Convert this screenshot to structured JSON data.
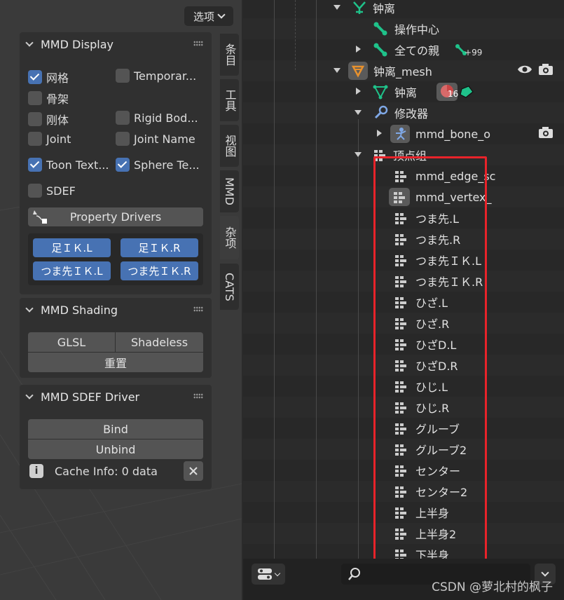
{
  "viewport": {
    "options_label": "选项",
    "tabs": [
      "条目",
      "工具",
      "视图",
      "MMD",
      "杂项",
      "CATS"
    ],
    "active_tab": "杂项"
  },
  "mmd_display": {
    "title": "MMD Display",
    "checks": [
      {
        "label": "网格",
        "checked": true
      },
      {
        "label": "Temporar...",
        "checked": false
      },
      {
        "label": "骨架",
        "checked": false
      },
      {
        "label": "刚体",
        "checked": false
      },
      {
        "label": "Rigid Bod...",
        "checked": false
      },
      {
        "label": "Joint",
        "checked": false
      },
      {
        "label": "Joint Name",
        "checked": false
      },
      {
        "label": "Toon Text...",
        "checked": true
      },
      {
        "label": "Sphere Te...",
        "checked": true
      },
      {
        "label": "SDEF",
        "checked": false
      }
    ],
    "property_drivers": "Property Drivers",
    "ik_buttons": [
      "足ＩＫ.L",
      "足ＩＫ.R",
      "つま先ＩＫ.L",
      "つま先ＩＫ.R"
    ]
  },
  "mmd_shading": {
    "title": "MMD Shading",
    "glsl": "GLSL",
    "shadeless": "Shadeless",
    "reset": "重置"
  },
  "mmd_sdef": {
    "title": "MMD SDEF Driver",
    "bind": "Bind",
    "unbind": "Unbind",
    "cache_info": "Cache Info: 0 data"
  },
  "outliner": {
    "armature": "钟离",
    "op_center": "操作中心",
    "all_parent": "全ての親",
    "all_parent_badge": "99",
    "mesh": "钟离_mesh",
    "mesh_data": "钟离",
    "material_count": "16",
    "modifiers": "修改器",
    "modifier_name": "mmd_bone_o",
    "vertex_groups_label": "顶点组",
    "vertex_groups": [
      "mmd_edge_sc",
      "mmd_vertex_",
      "つま先.L",
      "つま先.R",
      "つま先ＩＫ.L",
      "つま先ＩＫ.R",
      "ひざ.L",
      "ひざ.R",
      "ひざD.L",
      "ひざD.R",
      "ひじ.L",
      "ひじ.R",
      "グルーブ",
      "グルーブ2",
      "センター",
      "センター2",
      "上半身",
      "上半身2",
      "下半身"
    ]
  },
  "watermark": "CSDN @萝北村的枫子",
  "colors": {
    "accent": "#4772b3",
    "highlight": "#e8232a",
    "bone": "#1fc28a",
    "mesh": "#e8912d"
  }
}
